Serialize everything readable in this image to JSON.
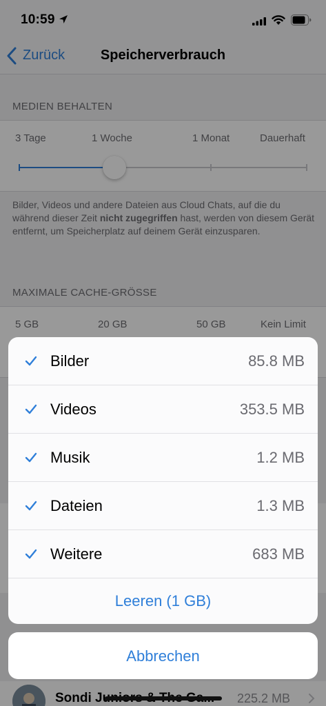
{
  "status_bar": {
    "time": "10:59"
  },
  "nav": {
    "back_label": "Zurück",
    "title": "Speicherverbrauch"
  },
  "keep_media": {
    "header": "MEDIEN BEHALTEN",
    "options": [
      "3 Tage",
      "1 Woche",
      "1 Monat",
      "Dauerhaft"
    ],
    "selected_index": 1,
    "footnote_before": "Bilder, Videos und andere Dateien aus Cloud Chats, auf die du während dieser Zeit ",
    "footnote_bold": "nicht zugegriffen",
    "footnote_after": " hast, werden von diesem Gerät entfernt, um Speicherplatz auf deinem Gerät einzusparen."
  },
  "max_cache": {
    "header": "MAXIMALE CACHE-GRÖSSE",
    "options": [
      "5 GB",
      "20 GB",
      "50 GB",
      "Kein Limit"
    ]
  },
  "storage_list": [
    {
      "name": "Sondi Juniors & The Ga...",
      "size": "225.2 MB"
    }
  ],
  "action_sheet": {
    "items": [
      {
        "label": "Bilder",
        "size": "85.8 MB",
        "checked": true
      },
      {
        "label": "Videos",
        "size": "353.5 MB",
        "checked": true
      },
      {
        "label": "Musik",
        "size": "1.2 MB",
        "checked": true
      },
      {
        "label": "Dateien",
        "size": "1.3 MB",
        "checked": true
      },
      {
        "label": "Weitere",
        "size": "683 MB",
        "checked": true
      }
    ],
    "clear_label": "Leeren (1 GB)",
    "cancel_label": "Abbrechen"
  },
  "colors": {
    "accent": "#2f7fd9",
    "secondary_text": "#6d6d72"
  }
}
